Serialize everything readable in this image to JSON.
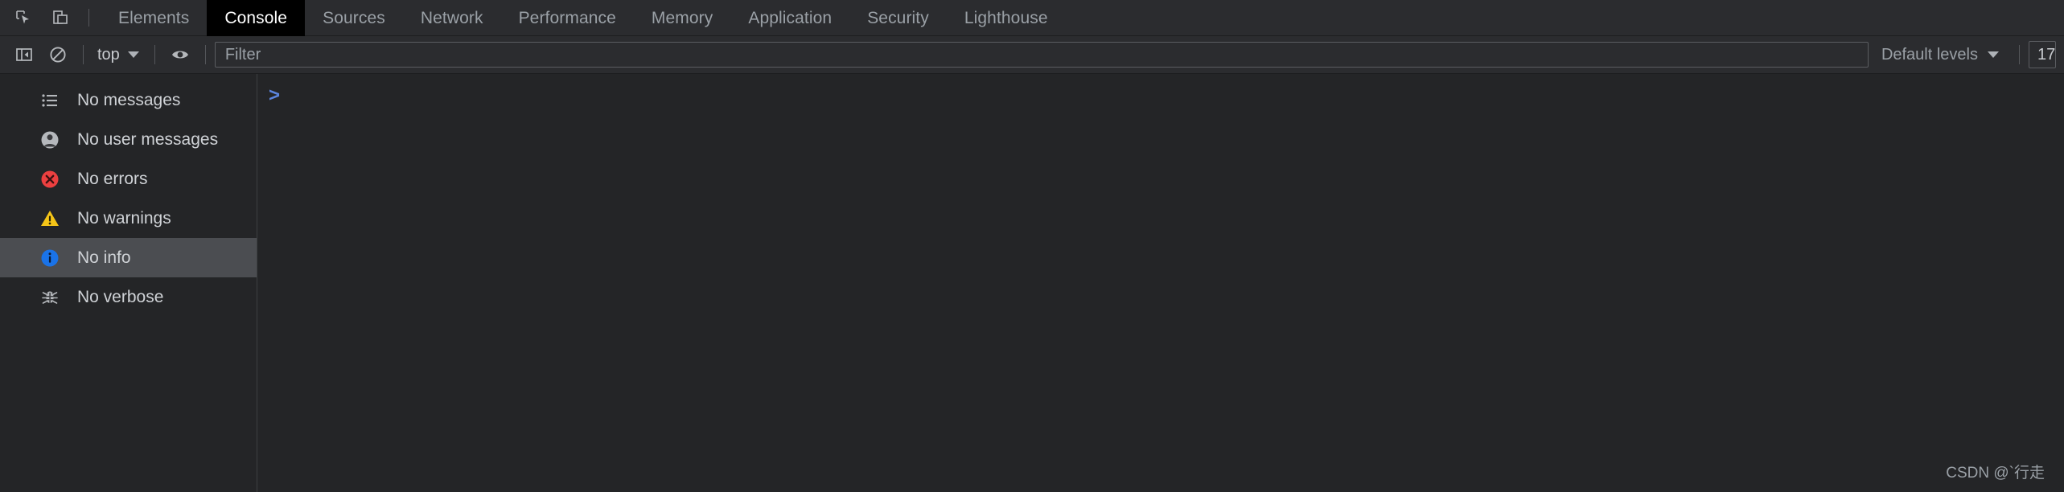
{
  "window": {
    "background": "#242527",
    "panel_background": "#2b2c2f"
  },
  "tabbar": {
    "inspect_icon": "inspect-cursor-icon",
    "device_icon": "device-toolbar-icon",
    "tabs": [
      {
        "label": "Elements",
        "active": false
      },
      {
        "label": "Console",
        "active": true
      },
      {
        "label": "Sources",
        "active": false
      },
      {
        "label": "Network",
        "active": false
      },
      {
        "label": "Performance",
        "active": false
      },
      {
        "label": "Memory",
        "active": false
      },
      {
        "label": "Application",
        "active": false
      },
      {
        "label": "Security",
        "active": false
      },
      {
        "label": "Lighthouse",
        "active": false
      }
    ]
  },
  "filterbar": {
    "sidebar_toggle_icon": "console-sidebar-toggle-icon",
    "clear_console_icon": "clear-console-icon",
    "context_value": "top",
    "eye_icon": "live-expression-eye-icon",
    "filter_value": "",
    "filter_placeholder": "Filter",
    "levels_label": "Default levels",
    "issues_count": "17"
  },
  "sidebar": {
    "items": [
      {
        "label": "No messages",
        "icon": "list-icon",
        "selected": false
      },
      {
        "label": "No user messages",
        "icon": "person-icon",
        "selected": false
      },
      {
        "label": "No errors",
        "icon": "error-icon",
        "selected": false
      },
      {
        "label": "No warnings",
        "icon": "warning-icon",
        "selected": false
      },
      {
        "label": "No info",
        "icon": "info-icon",
        "selected": true
      },
      {
        "label": "No verbose",
        "icon": "bug-icon",
        "selected": false
      }
    ]
  },
  "console": {
    "prompt_symbol": ">",
    "input_value": ""
  },
  "watermark": {
    "text": "CSDN @`行走"
  },
  "colors": {
    "error": "#ec4040",
    "warning": "#f5c518",
    "info": "#1a73e8",
    "prompt": "#5c85de",
    "selection": "#4b4d51"
  }
}
